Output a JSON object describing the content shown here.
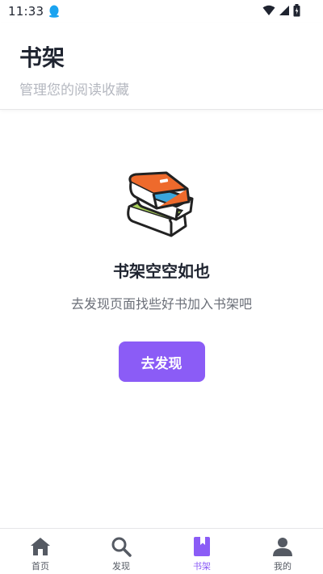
{
  "status": {
    "time": "11:33"
  },
  "header": {
    "title": "书架",
    "subtitle": "管理您的阅读收藏"
  },
  "empty_state": {
    "title": "书架空空如也",
    "description": "去发现页面找些好书加入书架吧",
    "button_label": "去发现",
    "illustration": "books-stack-icon"
  },
  "nav": {
    "items": [
      {
        "label": "首页",
        "icon": "home-icon"
      },
      {
        "label": "发现",
        "icon": "search-icon"
      },
      {
        "label": "书架",
        "icon": "bookshelf-icon",
        "active": true
      },
      {
        "label": "我的",
        "icon": "profile-icon"
      }
    ]
  },
  "colors": {
    "accent": "#8b5cf6",
    "inactive": "#555a63",
    "book_orange": "#ee6a2c",
    "book_blue": "#3aa6dc",
    "book_green": "#a8d05a"
  }
}
